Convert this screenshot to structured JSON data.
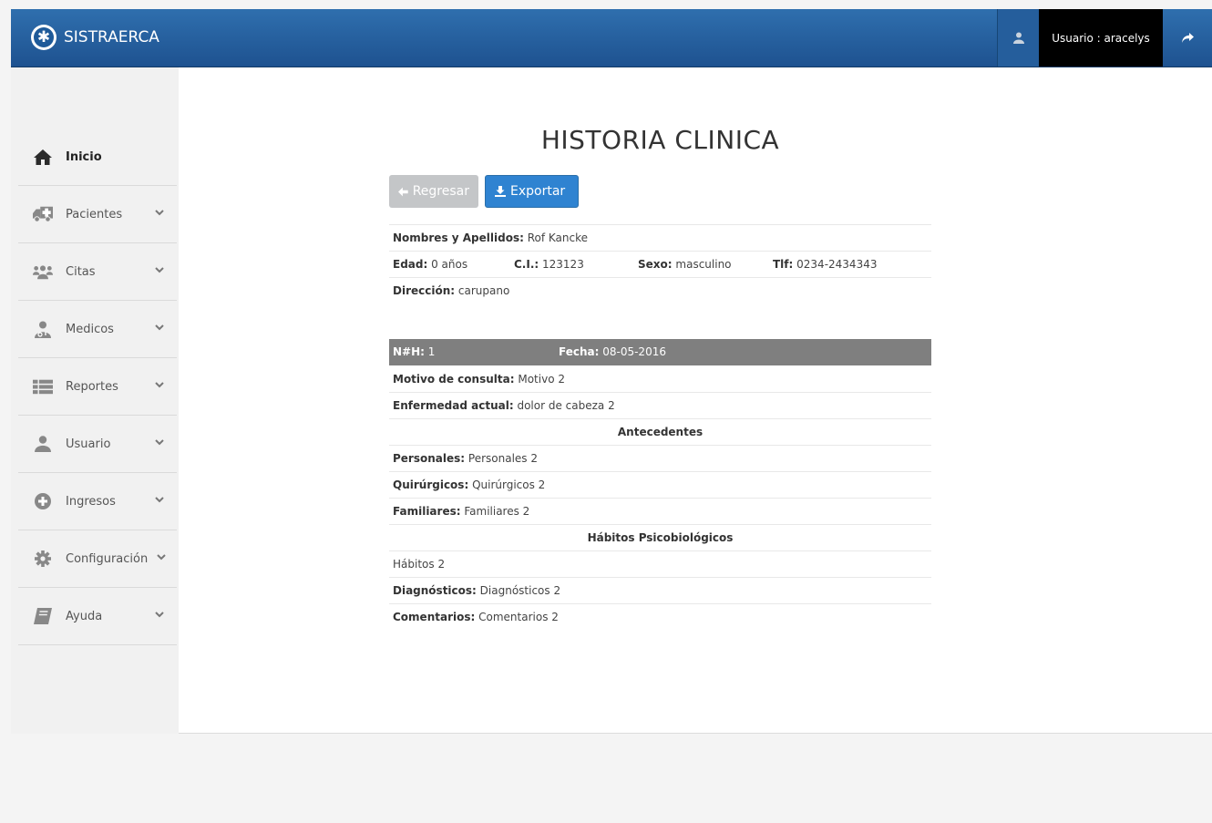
{
  "brand": {
    "name": "SISTRAERCA"
  },
  "navbar": {
    "username": "Usuario : aracelys"
  },
  "sidebar": {
    "items": [
      {
        "label": "Inicio",
        "icon": "home-icon"
      },
      {
        "label": "Pacientes",
        "icon": "ambulance-icon"
      },
      {
        "label": "Citas",
        "icon": "users-icon"
      },
      {
        "label": "Medicos",
        "icon": "doctor-icon"
      },
      {
        "label": "Reportes",
        "icon": "list-icon"
      },
      {
        "label": "Usuario",
        "icon": "user-icon"
      },
      {
        "label": "Ingresos",
        "icon": "plus-circle-icon"
      },
      {
        "label": "Configuración",
        "icon": "gear-icon"
      },
      {
        "label": "Ayuda",
        "icon": "book-icon"
      }
    ]
  },
  "page": {
    "title": "HISTORIA CLINICA"
  },
  "buttons": {
    "back": "Regresar",
    "export": "Exportar"
  },
  "patient": {
    "name_label": "Nombres y Apellidos:",
    "name": "Rof Kancke",
    "age_label": "Edad:",
    "age": "0 años",
    "ci_label": "C.I.:",
    "ci": "123123",
    "sex_label": "Sexo:",
    "sex": "masculino",
    "phone_label": "Tlf:",
    "phone": "0234-2434343",
    "address_label": "Dirección:",
    "address": "carupano"
  },
  "record": {
    "nh_label": "N#H:",
    "nh": "1",
    "date_label": "Fecha:",
    "date": "08-05-2016",
    "motivo_label": "Motivo de consulta:",
    "motivo": "Motivo 2",
    "enfermedad_label": "Enfermedad actual:",
    "enfermedad": "dolor de cabeza 2",
    "antecedentes_heading": "Antecedentes",
    "personales_label": "Personales:",
    "personales": "Personales 2",
    "quirurgicos_label": "Quirúrgicos:",
    "quirurgicos": "Quirúrgicos 2",
    "familiares_label": "Familiares:",
    "familiares": "Familiares 2",
    "habitos_heading": "Hábitos Psicobiológicos",
    "habitos": "Hábitos 2",
    "diagnosticos_label": "Diagnósticos:",
    "diagnosticos": "Diagnósticos 2",
    "comentarios_label": "Comentarios:",
    "comentarios": "Comentarios 2"
  },
  "colors": {
    "navbar": "#1e5290",
    "band": "#7f7f7f",
    "export_button": "#2f83d1",
    "back_button": "#c4c6c8"
  }
}
